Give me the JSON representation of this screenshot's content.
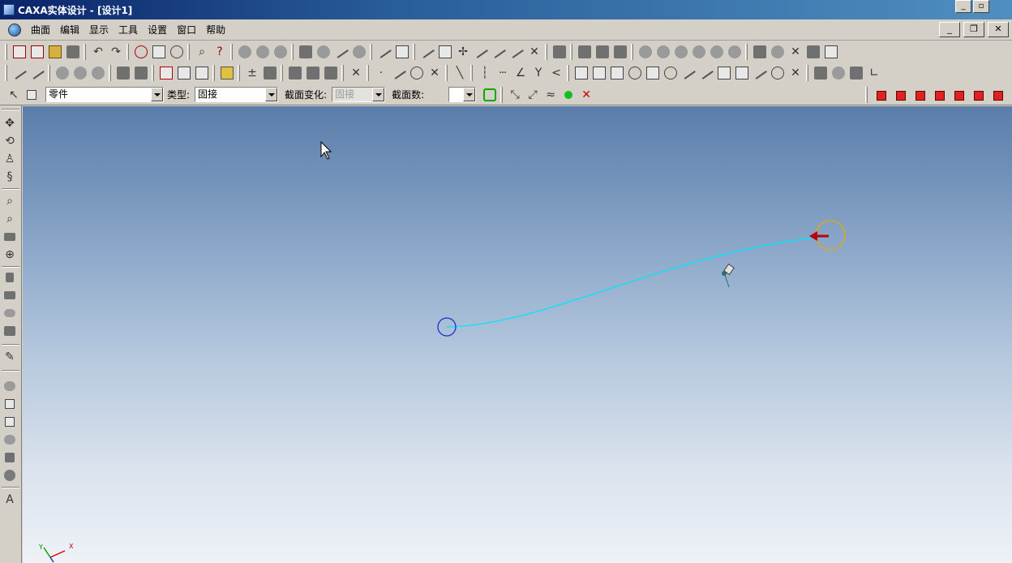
{
  "window": {
    "title": "CAXA实体设计 - [设计1]",
    "controls": [
      "minimize",
      "restore",
      "close"
    ]
  },
  "menubar": {
    "items": [
      "曲面",
      "编辑",
      "显示",
      "工具",
      "设置",
      "窗口",
      "帮助"
    ]
  },
  "property_bar": {
    "object_select": "零件",
    "type_label": "类型:",
    "type_value": "固接",
    "section_change_label": "截面变化:",
    "section_change_value": "固接",
    "section_count_label": "截面数:",
    "section_count_value": ""
  },
  "axis_triad": {
    "x_label": "X",
    "y_label": "Y"
  },
  "colors": {
    "curve": "#00e5ff",
    "start_circle": "#1a2fd0",
    "end_circle": "#e8a800",
    "end_arrow": "#c00000"
  }
}
